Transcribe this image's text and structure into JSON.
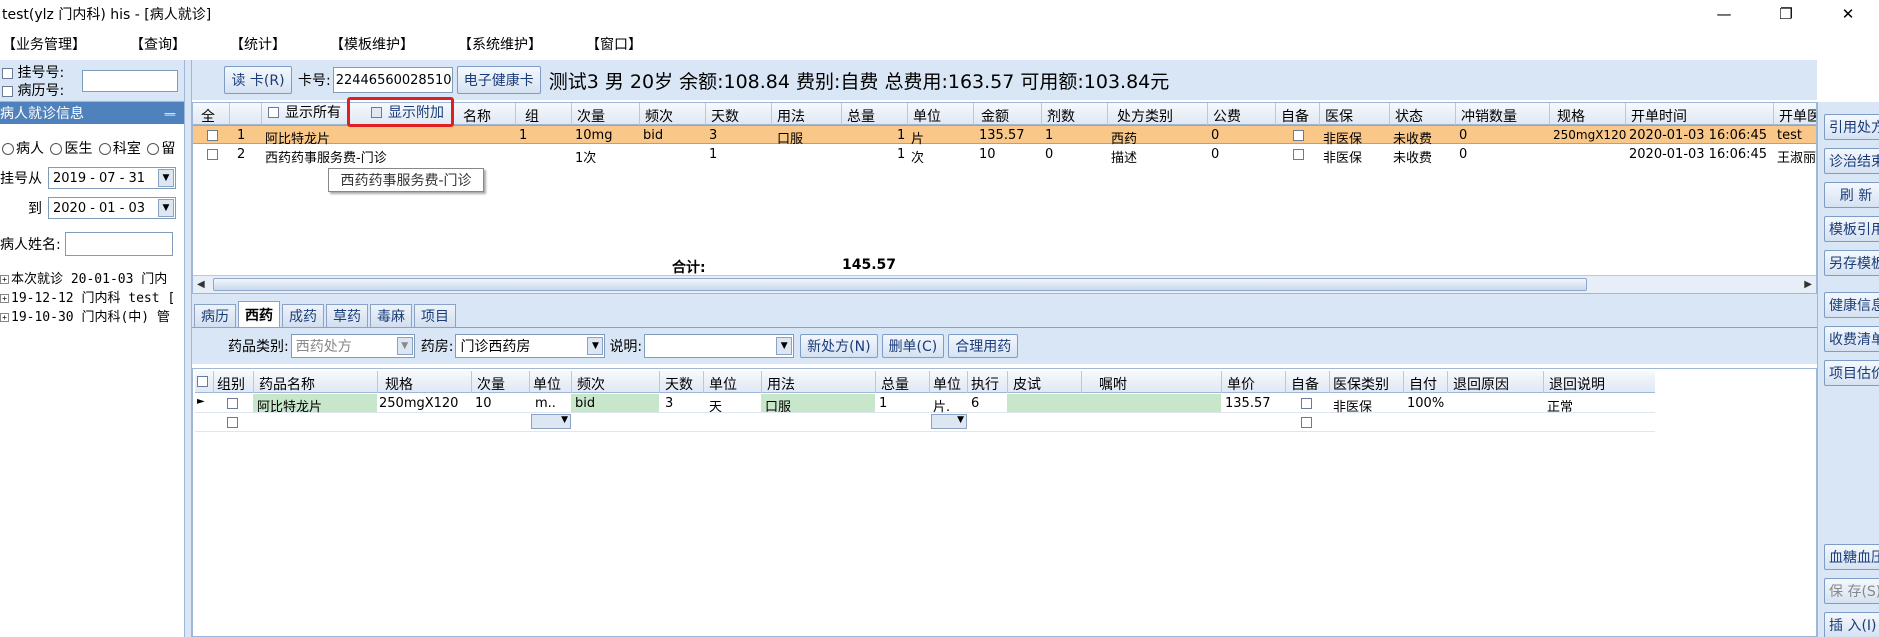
{
  "window": {
    "title": "test(ylz 门内科) his - [病人就诊]",
    "controls": [
      "—",
      "❐",
      "✕"
    ]
  },
  "menu": [
    "【业务管理】",
    "【查询】",
    "【统计】",
    "【模板维护】",
    "【系统维护】",
    "【窗口】"
  ],
  "left": {
    "reg_no_label": "挂号号:",
    "record_no_label": "病历号:",
    "panel_title": "病人就诊信息",
    "pin": "ᆖ",
    "radio_patient": "病人",
    "radio_doctor": "医生",
    "radio_dept": "科室",
    "radio_stay": "留",
    "reg_from_label": "挂号从",
    "reg_from_value": "2019 - 07 - 31",
    "reg_to_label": "到",
    "reg_to_value": "2020 - 01 - 03",
    "patient_name_label": "病人姓名:",
    "tree": [
      "本次就诊 20-01-03 门内",
      "19-12-12 门内科 test [",
      "19-10-30 门内科(中) 管"
    ]
  },
  "toolbar": {
    "read_card": "读 卡(R)",
    "card_label": "卡号:",
    "card_value": "224465600285108",
    "health_card": "电子健康卡",
    "patient_info": "测试3 男 20岁 余额:108.84 费别:自费 总费用:163.57 可用额:103.84元"
  },
  "upper": {
    "show_all": "显示所有",
    "show_extra": "显示附加",
    "headers": [
      "全",
      "名称",
      "组",
      "次量",
      "频次",
      "天数",
      "用法",
      "总量",
      "单位",
      "金额",
      "剂数",
      "处方类别",
      "公费",
      "自备",
      "医保",
      "状态",
      "冲销数量",
      "规格",
      "开单时间",
      "开单医"
    ],
    "rows": [
      {
        "no": "1",
        "name": "阿比特龙片",
        "group": "1",
        "dose": "10mg",
        "freq": "bid",
        "days": "3",
        "usage": "口服",
        "total": "1",
        "unit": "片",
        "amount": "135.57",
        "doses": "1",
        "type": "西药",
        "public": "0",
        "ins": "非医保",
        "status": "未收费",
        "offset": "0",
        "spec": "250mgX120",
        "time": "2020-01-03 16:06:45",
        "doctor": "test"
      },
      {
        "no": "2",
        "name": "西药药事服务费-门诊",
        "group": "",
        "dose": "1次",
        "freq": "",
        "days": "1",
        "usage": "",
        "total": "1",
        "unit": "次",
        "amount": "10",
        "doses": "0",
        "type": "描述",
        "public": "0",
        "ins": "非医保",
        "status": "未收费",
        "offset": "0",
        "spec": "",
        "time": "2020-01-03 16:06:45",
        "doctor": "王淑丽"
      }
    ],
    "tooltip": "西药药事服务费-门诊",
    "total_label": "合计:",
    "total_value": "145.57"
  },
  "tabs": [
    "病历",
    "西药",
    "成药",
    "草药",
    "毒麻",
    "项目"
  ],
  "lower_toolbar": {
    "drug_type_label": "药品类别:",
    "drug_type_value": "西药处方",
    "pharmacy_label": "药房:",
    "pharmacy_value": "门诊西药房",
    "note_label": "说明:",
    "new_rx": "新处方(N)",
    "delete_rx": "删单(C)",
    "rational": "合理用药"
  },
  "lower": {
    "headers": [
      "组别",
      "药品名称",
      "规格",
      "次量",
      "单位",
      "频次",
      "天数",
      "单位",
      "用法",
      "总量",
      "单位",
      "执行",
      "皮试",
      "嘱咐",
      "单价",
      "自备",
      "医保类别",
      "自付",
      "退回原因",
      "退回说明"
    ],
    "row": {
      "name": "阿比特龙片",
      "spec": "250mgX120",
      "dose": "10",
      "dose_unit": "m..",
      "freq": "bid",
      "days": "3",
      "day_unit": "天",
      "usage": "口服",
      "total": "1",
      "total_unit": "片.",
      "exec": "6",
      "price": "135.57",
      "ins_type": "非医保",
      "self_pay": "100%",
      "return_note": "正常"
    }
  },
  "right": [
    "引用处方",
    "诊治结束",
    "刷 新",
    "模板引用",
    "另存模板",
    "健康信息",
    "收费清单",
    "项目估价",
    "血糖血压",
    "保 存(S)",
    "插 入(I)"
  ]
}
